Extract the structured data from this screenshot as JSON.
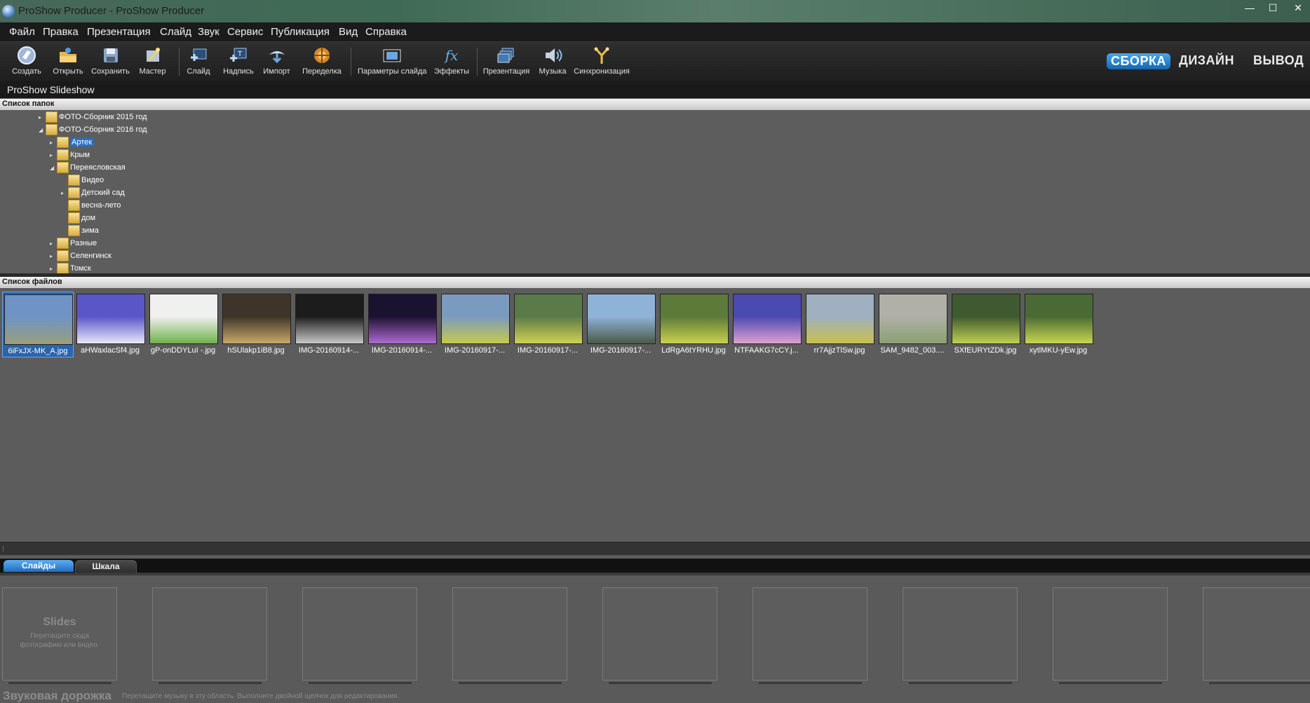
{
  "window": {
    "title": "ProShow Producer - ProShow Producer",
    "minimize": "—",
    "maximize": "☐",
    "close": "✕"
  },
  "menu": [
    "Файл",
    "Правка",
    "Презентация",
    "Слайд",
    "Звук",
    "Сервис",
    "Публикация",
    "Вид",
    "Справка"
  ],
  "toolbar": {
    "buttons": [
      {
        "label": "Создать",
        "icon": "create-icon"
      },
      {
        "label": "Открыть",
        "icon": "open-folder-icon"
      },
      {
        "label": "Сохранить",
        "icon": "save-icon"
      },
      {
        "label": "Мастер",
        "icon": "wizard-icon"
      },
      {
        "label": "Слайд",
        "icon": "add-slide-icon"
      },
      {
        "label": "Надпись",
        "icon": "caption-icon"
      },
      {
        "label": "Импорт",
        "icon": "import-icon"
      },
      {
        "label": "Переделка",
        "icon": "remix-icon"
      },
      {
        "label": "Параметры слайда",
        "icon": "slide-options-icon"
      },
      {
        "label": "Эффекты",
        "icon": "effects-icon"
      },
      {
        "label": "Презентация",
        "icon": "show-icon"
      },
      {
        "label": "Музыка",
        "icon": "music-icon"
      },
      {
        "label": "Синхронизация",
        "icon": "sync-icon"
      }
    ],
    "modes": [
      "СБОРКА",
      "ДИЗАЙН",
      "ВЫВОД"
    ],
    "active_mode": "СБОРКА"
  },
  "show": {
    "title": "ProShow Slideshow"
  },
  "folders": {
    "header": "Список папок",
    "items": [
      {
        "label": "ФОТО-Сборник 2015 год",
        "level": 0,
        "expander": "▸"
      },
      {
        "label": "ФОТО-Сборник 2016 год",
        "level": 0,
        "expander": "◢"
      },
      {
        "label": "Артек",
        "level": 1,
        "expander": "▸",
        "selected": true
      },
      {
        "label": "Крым",
        "level": 1,
        "expander": "▸"
      },
      {
        "label": "Переясловская",
        "level": 1,
        "expander": "◢"
      },
      {
        "label": "Видео",
        "level": 2,
        "expander": ""
      },
      {
        "label": "Детский сад",
        "level": 2,
        "expander": "▸"
      },
      {
        "label": "весна-лето",
        "level": 2,
        "expander": ""
      },
      {
        "label": "дом",
        "level": 2,
        "expander": ""
      },
      {
        "label": "зима",
        "level": 2,
        "expander": ""
      },
      {
        "label": "Разные",
        "level": 1,
        "expander": "▸"
      },
      {
        "label": "Селенгинск",
        "level": 1,
        "expander": "▸"
      },
      {
        "label": "Томск",
        "level": 1,
        "expander": "▸"
      }
    ]
  },
  "files": {
    "header": "Список файлов",
    "items": [
      {
        "name": "6iFxJX-MK_A.jpg",
        "selected": true,
        "c1": "#6f93c4",
        "c2": "#9aa07a"
      },
      {
        "name": "aHWaxlacSf4.jpg",
        "c1": "#5a56c8",
        "c2": "#e8e8f8"
      },
      {
        "name": "gP-onDDYLuI -.jpg",
        "c1": "#f0f0f0",
        "c2": "#6fb34a"
      },
      {
        "name": "hSUlakp1iB8.jpg",
        "c1": "#3d3529",
        "c2": "#c9a86a"
      },
      {
        "name": "IMG-20160914-...",
        "c1": "#1c1c1c",
        "c2": "#c8c8c8"
      },
      {
        "name": "IMG-20160914-...",
        "c1": "#1a1230",
        "c2": "#b06ad0"
      },
      {
        "name": "IMG-20160917-...",
        "c1": "#7b9ac0",
        "c2": "#c6c94a"
      },
      {
        "name": "IMG-20160917-...",
        "c1": "#5a7a4a",
        "c2": "#d0d24e"
      },
      {
        "name": "IMG-20160917-...",
        "c1": "#8fb3d8",
        "c2": "#4a5a48"
      },
      {
        "name": "LdRgA6tYRHU.jpg",
        "c1": "#5c7a3a",
        "c2": "#c9d24a"
      },
      {
        "name": "NTFAAKG7cCY.j...",
        "c1": "#4a4ab0",
        "c2": "#e0a0d0"
      },
      {
        "name": "rr7AjjzTlSw.jpg",
        "c1": "#9fb0c0",
        "c2": "#c8c04a"
      },
      {
        "name": "SAM_9482_003....",
        "c1": "#b0b0a8",
        "c2": "#8aa070"
      },
      {
        "name": "SXfEURYtZDk.jpg",
        "c1": "#3f5a30",
        "c2": "#c0d050"
      },
      {
        "name": "xytlMKU-yEw.jpg",
        "c1": "#496a34",
        "c2": "#c9d64e"
      }
    ]
  },
  "tabs": [
    "Слайды",
    "Шкала"
  ],
  "slides": {
    "placeholder_title": "Slides",
    "placeholder_hint": "Перетащите сюда фотографию или видео.",
    "slot_count": 9
  },
  "audio": {
    "title": "Звуковая дорожка",
    "hint": "Перетащите музыку в эту область. Выполните двойной щелчок для редактирования."
  }
}
